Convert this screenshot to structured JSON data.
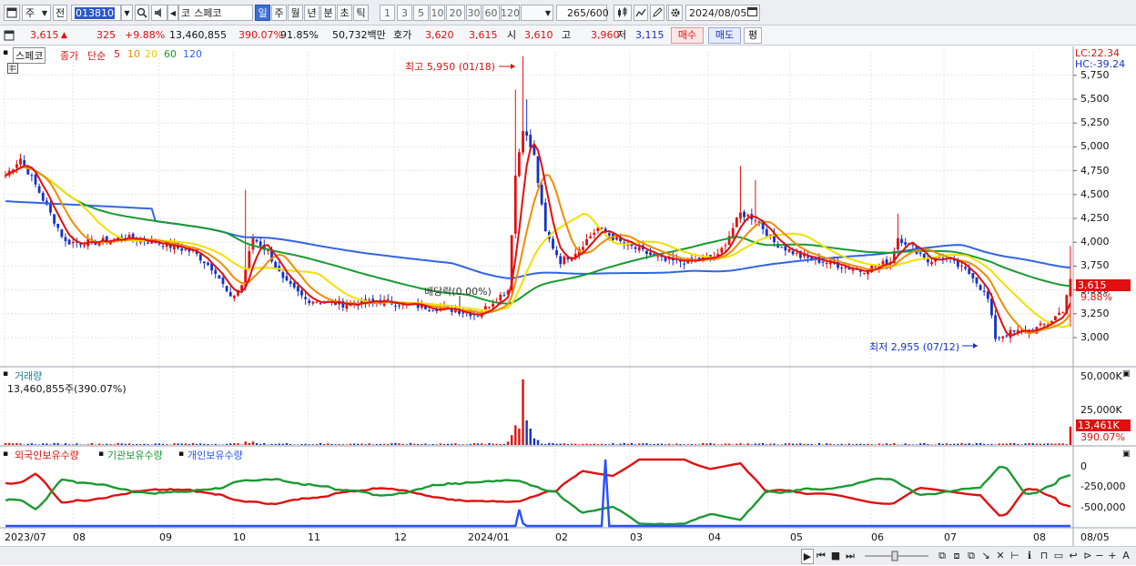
{
  "toolbar": {
    "market": "주",
    "prev": "전",
    "code": "013810",
    "market_type": "코",
    "stock_name": "스페코",
    "periods": [
      "일",
      "주",
      "월",
      "년",
      "분",
      "초",
      "틱"
    ],
    "active_period": "일",
    "intervals": [
      "1",
      "3",
      "5",
      "10",
      "20",
      "30",
      "60",
      "120"
    ],
    "count": "265",
    "count_max": "/600",
    "date": "2024/08/05"
  },
  "quote": {
    "price": "3,615",
    "change_arrow": "▲",
    "change": "325",
    "change_pct": "+9.88%",
    "volume": "13,460,855",
    "volume_ratio": "390.07%",
    "turnover_pct": "91.85%",
    "amount": "50,732백만",
    "hoga_label": "호가",
    "ask": "3,620",
    "bid": "3,615",
    "open_label": "시",
    "open": "3,610",
    "high_label": "고",
    "high": "3,960",
    "low_label": "저",
    "low": "3,115",
    "buy_label": "매수",
    "sell_label": "매도",
    "avg_label": "평"
  },
  "legend": {
    "stock": "스페코",
    "price_label": "종가",
    "ma_type": "단순",
    "ma_periods": [
      "5",
      "10",
      "20",
      "60",
      "120"
    ]
  },
  "colors": {
    "up": "#e01010",
    "down": "#1432c8",
    "ma5": "#e01010",
    "ma10": "#f08c00",
    "ma20": "#f0e000",
    "ma60": "#1a9a32",
    "ma120": "#3264e6",
    "foreign": "#e01010",
    "institution": "#1a9a32",
    "individual": "#2850ff"
  },
  "price_panel": {
    "lc": "LC:22.34",
    "hc": "HC:-39.24",
    "current_tag": "3,615",
    "pct_tag": "9.88%",
    "high_marker": "최고 5,950 (01/18)",
    "low_marker": "최저 2,955 (07/12)",
    "dividend_marker": "배당락(0.00%)"
  },
  "volume_panel": {
    "title": "거래량",
    "value": "13,460,855주(390.07%)",
    "current_tag": "13,461K",
    "pct_tag": "390.07%",
    "ticks": [
      "50,000K",
      "25,000K"
    ]
  },
  "holding_panel": {
    "foreign_label": "외국인보유수량",
    "institution_label": "기관보유수량",
    "individual_label": "개인보유수량",
    "ticks": [
      "0",
      "-250,000",
      "-500,000"
    ]
  },
  "x_axis": [
    "2023/07",
    "08",
    "09",
    "10",
    "11",
    "12",
    "2024/01",
    "02",
    "03",
    "04",
    "05",
    "06",
    "07",
    "08",
    "08/05"
  ],
  "chart_data": {
    "type": "candlestick",
    "y_axis_ticks": [
      "3,000",
      "3,250",
      "3,500",
      "3,750",
      "4,000",
      "4,250",
      "4,500",
      "4,750",
      "5,000",
      "5,250",
      "5,500",
      "5,750"
    ],
    "ylim": [
      2880,
      5950
    ],
    "months": [
      "2023/07",
      "08",
      "09",
      "10",
      "11",
      "12",
      "2024/01",
      "02",
      "03",
      "04",
      "05",
      "06",
      "07",
      "08"
    ],
    "close_keyframes": [
      [
        0,
        4700
      ],
      [
        4,
        4880
      ],
      [
        8,
        4600
      ],
      [
        12,
        4300
      ],
      [
        16,
        4000
      ],
      [
        24,
        4000
      ],
      [
        32,
        4050
      ],
      [
        40,
        4000
      ],
      [
        50,
        3900
      ],
      [
        56,
        3700
      ],
      [
        60,
        3400
      ],
      [
        63,
        3550
      ],
      [
        66,
        4050
      ],
      [
        70,
        3900
      ],
      [
        74,
        3600
      ],
      [
        80,
        3400
      ],
      [
        90,
        3350
      ],
      [
        100,
        3380
      ],
      [
        110,
        3330
      ],
      [
        120,
        3290
      ],
      [
        126,
        3240
      ],
      [
        130,
        3380
      ],
      [
        134,
        3500
      ],
      [
        136,
        4700
      ],
      [
        138,
        5200
      ],
      [
        141,
        4900
      ],
      [
        144,
        4100
      ],
      [
        148,
        3800
      ],
      [
        152,
        3900
      ],
      [
        158,
        4150
      ],
      [
        164,
        4000
      ],
      [
        170,
        3900
      ],
      [
        176,
        3800
      ],
      [
        182,
        3800
      ],
      [
        190,
        3850
      ],
      [
        196,
        4300
      ],
      [
        200,
        4250
      ],
      [
        205,
        4000
      ],
      [
        212,
        3850
      ],
      [
        220,
        3780
      ],
      [
        228,
        3700
      ],
      [
        232,
        3750
      ],
      [
        236,
        3800
      ],
      [
        238,
        4050
      ],
      [
        242,
        3950
      ],
      [
        246,
        3800
      ],
      [
        250,
        3850
      ],
      [
        254,
        3750
      ],
      [
        258,
        3650
      ],
      [
        262,
        3400
      ],
      [
        264,
        3000
      ],
      [
        268,
        3050
      ],
      [
        274,
        3080
      ],
      [
        278,
        3150
      ],
      [
        282,
        3290
      ],
      [
        284,
        3615
      ]
    ],
    "high": "5,950",
    "low": "2,955"
  }
}
